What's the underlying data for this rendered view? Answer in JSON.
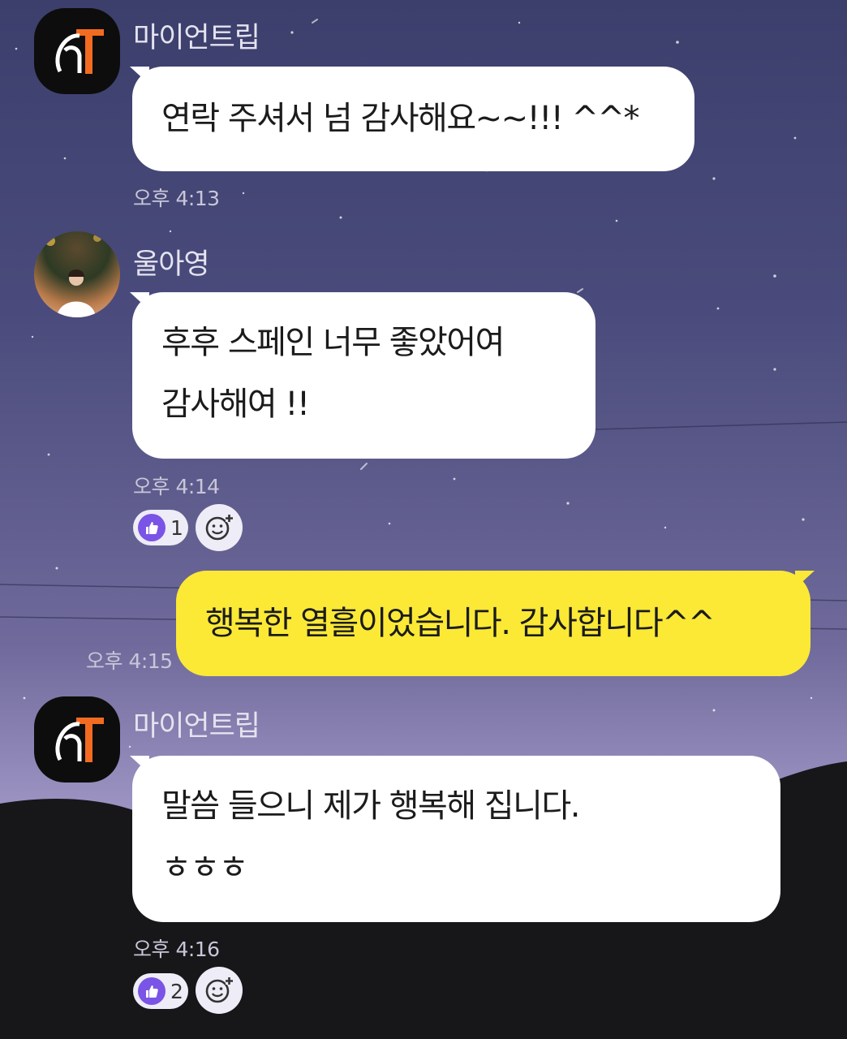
{
  "messages": [
    {
      "sender": "마이언트립",
      "lines": [
        "연락 주셔서 넘 감사해요~~!!! ^^*"
      ],
      "time": "오후 4:13"
    },
    {
      "sender": "울아영",
      "lines": [
        "후후 스페인 너무 좋았어여",
        "감사해여 !!"
      ],
      "time": "오후 4:14",
      "reaction_count": "1"
    },
    {
      "sender": "",
      "lines": [
        "행복한 열흘이었습니다. 감사합니다^^"
      ],
      "time": "오후 4:15"
    },
    {
      "sender": "마이언트립",
      "lines": [
        "말씀 들으니 제가 행복해 집니다.",
        "ㅎㅎㅎ"
      ],
      "time": "오후 4:16",
      "reaction_count": "2"
    }
  ],
  "colors": {
    "my_bubble": "#fbe936",
    "other_bubble": "#ffffff",
    "reaction_accent": "#7a54e6",
    "brand_orange": "#f26b21"
  },
  "icons": [
    "brand-logo-icon",
    "thumbs-up-icon",
    "add-reaction-icon"
  ]
}
